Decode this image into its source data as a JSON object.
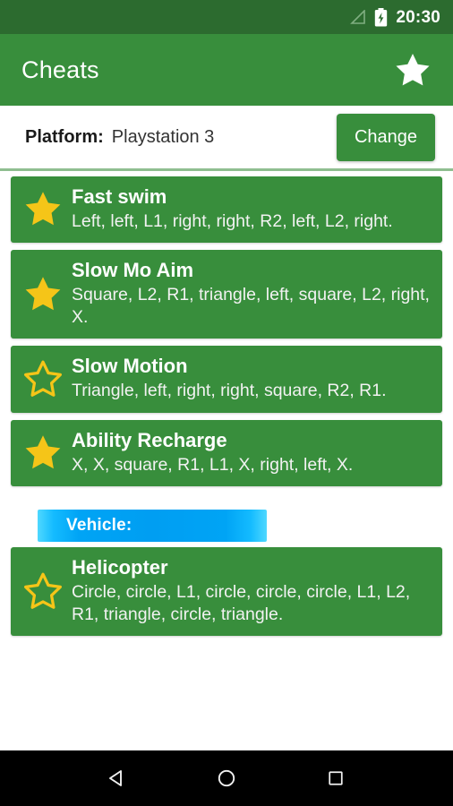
{
  "status_bar": {
    "time": "20:30",
    "signal_icon": "signal-triangle-icon",
    "battery_icon": "battery-charging-icon",
    "background_color": "#2C6B2F"
  },
  "app_bar": {
    "title": "Cheats",
    "favorite_icon": "star-filled-icon",
    "background_color": "#388E3C"
  },
  "platform": {
    "label": "Platform:",
    "value": "Playstation 3",
    "change_button": "Change"
  },
  "sections": [
    {
      "banner": null,
      "cheats": [
        {
          "name": "Fast swim",
          "code": "Left, left, L1, right, right, R2, left, L2, right.",
          "favorite": true,
          "star_icon": "star-filled-icon"
        },
        {
          "name": "Slow Mo Aim",
          "code": "Square, L2, R1, triangle, left, square, L2, right, X.",
          "favorite": true,
          "star_icon": "star-filled-icon"
        },
        {
          "name": "Slow Motion",
          "code": "Triangle, left, right, right, square, R2, R1.",
          "favorite": false,
          "star_icon": "star-outline-icon"
        },
        {
          "name": "Ability Recharge",
          "code": "X, X, square, R1, L1, X, right, left, X.",
          "favorite": true,
          "star_icon": "star-filled-icon"
        }
      ]
    },
    {
      "banner": "Vehicle:",
      "cheats": [
        {
          "name": "Helicopter",
          "code": "Circle, circle, L1, circle, circle, circle, L1, L2, R1, triangle, circle, triangle.",
          "favorite": false,
          "star_icon": "star-outline-icon"
        }
      ]
    }
  ],
  "nav_bar": {
    "back_icon": "back-triangle-icon",
    "home_icon": "home-circle-icon",
    "recents_icon": "recents-square-icon"
  },
  "colors": {
    "card_green": "#388E3C",
    "status_green": "#2C6B2F",
    "star_gold": "#F5C518",
    "banner_blue": "#009EF2"
  }
}
